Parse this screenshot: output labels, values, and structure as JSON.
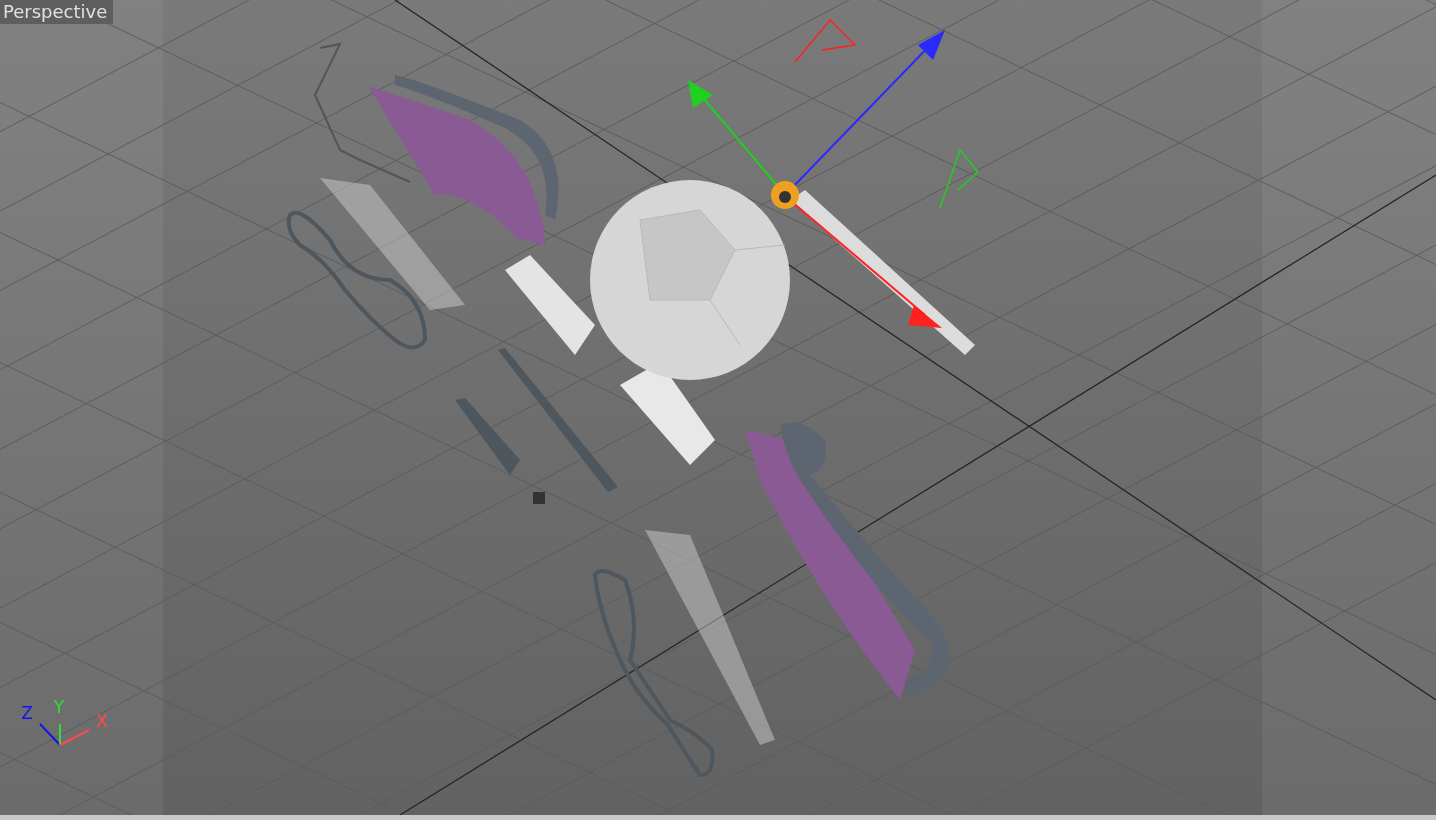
{
  "viewport": {
    "title": "Perspective"
  },
  "axis_gizmo": {
    "labels": [
      "Z",
      "Y",
      "X"
    ]
  }
}
